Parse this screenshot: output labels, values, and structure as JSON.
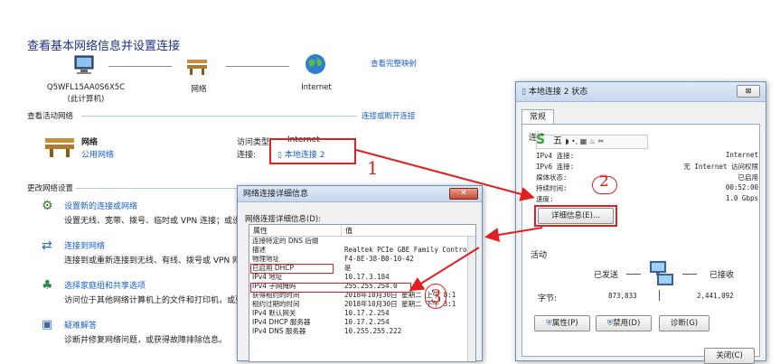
{
  "network_center": {
    "title": "查看基本网络信息并设置连接",
    "view_full_map": "查看完整映射",
    "nodes": {
      "computer_name": "Q5WFL15AA0S6X5C",
      "computer_sub": "(此计算机)",
      "network": "网络",
      "internet": "Internet"
    },
    "active_networks_label": "查看活动网络",
    "connect_disconnect": "连接或断开连接",
    "network_name": "网络",
    "network_type": "公用网络",
    "access_type_label": "访问类型:",
    "access_type_value": "Internet",
    "connection_label": "连接:",
    "connection_value": "本地连接 2",
    "change_settings_label": "更改网络设置",
    "tasks": [
      {
        "title": "设置新的连接或网络",
        "desc": "设置无线、宽带、拨号、临时或 VPN 连接；或设"
      },
      {
        "title": "连接到网络",
        "desc": "连接到或重新连接到无线、有线、拨号或 VPN 网"
      },
      {
        "title": "选择家庭组和共享选项",
        "desc": "访问位于其他网络计算机上的文件和打印机，或更"
      },
      {
        "title": "疑难解答",
        "desc": "诊断并修复网络问题，或获得故障排除信息。"
      }
    ]
  },
  "status_dialog": {
    "title": "本地连接 2 状态",
    "tab": "常规",
    "connection_label": "连接",
    "rows": [
      {
        "label": "IPv4 连接:",
        "value": "Internet"
      },
      {
        "label": "IPv6 连接:",
        "value": "无 Internet 访问权限"
      },
      {
        "label": "媒体状态:",
        "value": "已启用"
      },
      {
        "label": "持续时间:",
        "value": "00:52:00"
      },
      {
        "label": "速度:",
        "value": "1.0 Gbps"
      }
    ],
    "details_button": "详细信息(E)...",
    "activity_label": "活动",
    "sent_label": "已发送",
    "received_label": "已接收",
    "bytes_label": "字节:",
    "bytes_sent": "873,833",
    "bytes_received": "2,441,092",
    "properties_button": "属性(P)",
    "disable_button": "禁用(D)",
    "diagnose_button": "诊断(G)",
    "close_button": "关闭(C)",
    "ime_text": "五"
  },
  "details_dialog": {
    "title": "网络连接详细信息",
    "subtitle": "网络连接详细信息(D):",
    "col_property": "属性",
    "col_value": "值",
    "rows": [
      {
        "property": "连接特定的 DNS 后缀",
        "value": ""
      },
      {
        "property": "描述",
        "value": "Realtek PCIe GBE Family Contro"
      },
      {
        "property": "物理地址",
        "value": "F4-8E-38-B0-10-42"
      },
      {
        "property": "已启用 DHCP",
        "value": "是"
      },
      {
        "property": "IPv4 地址",
        "value": "10.17.3.184"
      },
      {
        "property": "IPv4 子网掩码",
        "value": "255.255.254.0"
      },
      {
        "property": "获得租约的时间",
        "value": "2018年10月30日 星期二 上午 8:1"
      },
      {
        "property": "租约过期的时间",
        "value": "2018年10月30日 星期二 下午 3:1"
      },
      {
        "property": "IPv4 默认网关",
        "value": "10.17.2.254"
      },
      {
        "property": "IPv4 DHCP 服务器",
        "value": "10.17.2.254"
      },
      {
        "property": "IPv4 DNS 服务器",
        "value": "10.255.255.222"
      }
    ]
  },
  "annotations": {
    "step1": "1",
    "step2": "2",
    "step3": "3"
  },
  "colors": {
    "accent_red": "#e02020",
    "link_blue": "#1a5fc8",
    "title_blue": "#1e3287"
  }
}
